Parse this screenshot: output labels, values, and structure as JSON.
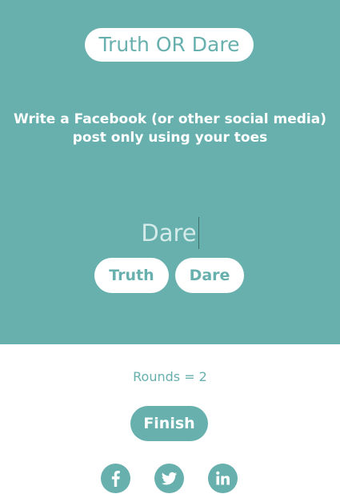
{
  "header": {
    "title": "Truth OR Dare"
  },
  "prompt": {
    "text": "Write a Facebook (or other social media) post only using your toes"
  },
  "mode": {
    "current": "Dare"
  },
  "buttons": {
    "truth": "Truth",
    "dare": "Dare"
  },
  "rounds": {
    "label": "Rounds = 2"
  },
  "finish": {
    "label": "Finish"
  },
  "social": [
    {
      "icon": "facebook-icon"
    },
    {
      "icon": "twitter-icon"
    },
    {
      "icon": "linkedin-icon"
    }
  ],
  "colors": {
    "accent": "#67b0ae",
    "background": "#ffffff"
  }
}
